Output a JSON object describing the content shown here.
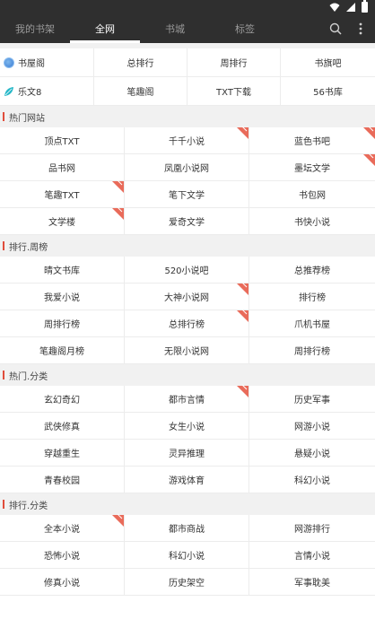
{
  "tabs": [
    {
      "label": "我的书架",
      "active": false
    },
    {
      "label": "全网",
      "active": true
    },
    {
      "label": "书城",
      "active": false
    },
    {
      "label": "标签",
      "active": false
    }
  ],
  "sites": [
    [
      "书屋阁",
      "总排行",
      "周排行",
      "书旗吧"
    ],
    [
      "乐文8",
      "笔趣阁",
      "TXT下载",
      "56书库"
    ]
  ],
  "sections": [
    {
      "title": "热门网站",
      "rows": [
        [
          {
            "t": "顶点TXT",
            "hot": false
          },
          {
            "t": "千千小说",
            "hot": true
          },
          {
            "t": "蓝色书吧",
            "hot": true
          }
        ],
        [
          {
            "t": "品书网",
            "hot": false
          },
          {
            "t": "凤凰小说网",
            "hot": false
          },
          {
            "t": "墨坛文学",
            "hot": true
          }
        ],
        [
          {
            "t": "笔趣TXT",
            "hot": true
          },
          {
            "t": "笔下文学",
            "hot": false
          },
          {
            "t": "书包网",
            "hot": false
          }
        ],
        [
          {
            "t": "文学楼",
            "hot": true
          },
          {
            "t": "爱奇文学",
            "hot": false
          },
          {
            "t": "书快小说",
            "hot": false
          }
        ]
      ]
    },
    {
      "title": "排行.周榜",
      "rows": [
        [
          {
            "t": "晴文书库",
            "hot": false
          },
          {
            "t": "520小说吧",
            "hot": false
          },
          {
            "t": "总推荐榜",
            "hot": false
          }
        ],
        [
          {
            "t": "我爱小说",
            "hot": false
          },
          {
            "t": "大神小说网",
            "hot": true
          },
          {
            "t": "排行榜",
            "hot": false
          }
        ],
        [
          {
            "t": "周排行榜",
            "hot": false
          },
          {
            "t": "总排行榜",
            "hot": true
          },
          {
            "t": "爪机书屋",
            "hot": false
          }
        ],
        [
          {
            "t": "笔趣阁月榜",
            "hot": false
          },
          {
            "t": "无限小说网",
            "hot": false
          },
          {
            "t": "周排行榜",
            "hot": false
          }
        ]
      ]
    },
    {
      "title": "热门.分类",
      "rows": [
        [
          {
            "t": "玄幻奇幻",
            "hot": false
          },
          {
            "t": "都市言情",
            "hot": true
          },
          {
            "t": "历史军事",
            "hot": false
          }
        ],
        [
          {
            "t": "武侠修真",
            "hot": false
          },
          {
            "t": "女生小说",
            "hot": false
          },
          {
            "t": "网游小说",
            "hot": false
          }
        ],
        [
          {
            "t": "穿越重生",
            "hot": false
          },
          {
            "t": "灵异推理",
            "hot": false
          },
          {
            "t": "悬疑小说",
            "hot": false
          }
        ],
        [
          {
            "t": "青春校园",
            "hot": false
          },
          {
            "t": "游戏体育",
            "hot": false
          },
          {
            "t": "科幻小说",
            "hot": false
          }
        ]
      ]
    },
    {
      "title": "排行.分类",
      "rows": [
        [
          {
            "t": "全本小说",
            "hot": true
          },
          {
            "t": "都市商战",
            "hot": false
          },
          {
            "t": "网游排行",
            "hot": false
          }
        ],
        [
          {
            "t": "恐怖小说",
            "hot": false
          },
          {
            "t": "科幻小说",
            "hot": false
          },
          {
            "t": "言情小说",
            "hot": false
          }
        ],
        [
          {
            "t": "修真小说",
            "hot": false
          },
          {
            "t": "历史架空",
            "hot": false
          },
          {
            "t": "军事耽美",
            "hot": false
          }
        ]
      ]
    }
  ],
  "colors": {
    "header_bg": "#2f2f2f",
    "accent": "#e04d3c",
    "hot_badge": "#e96b5a",
    "site_logo_1": "#3a7bd5",
    "site_logo_2": "#27b8c8"
  },
  "icons": {
    "wifi": "wifi-icon",
    "signal": "signal-icon",
    "battery": "battery-icon",
    "search": "search-icon",
    "more": "more-vertical-icon",
    "hot_badge": "hot-corner-icon"
  }
}
